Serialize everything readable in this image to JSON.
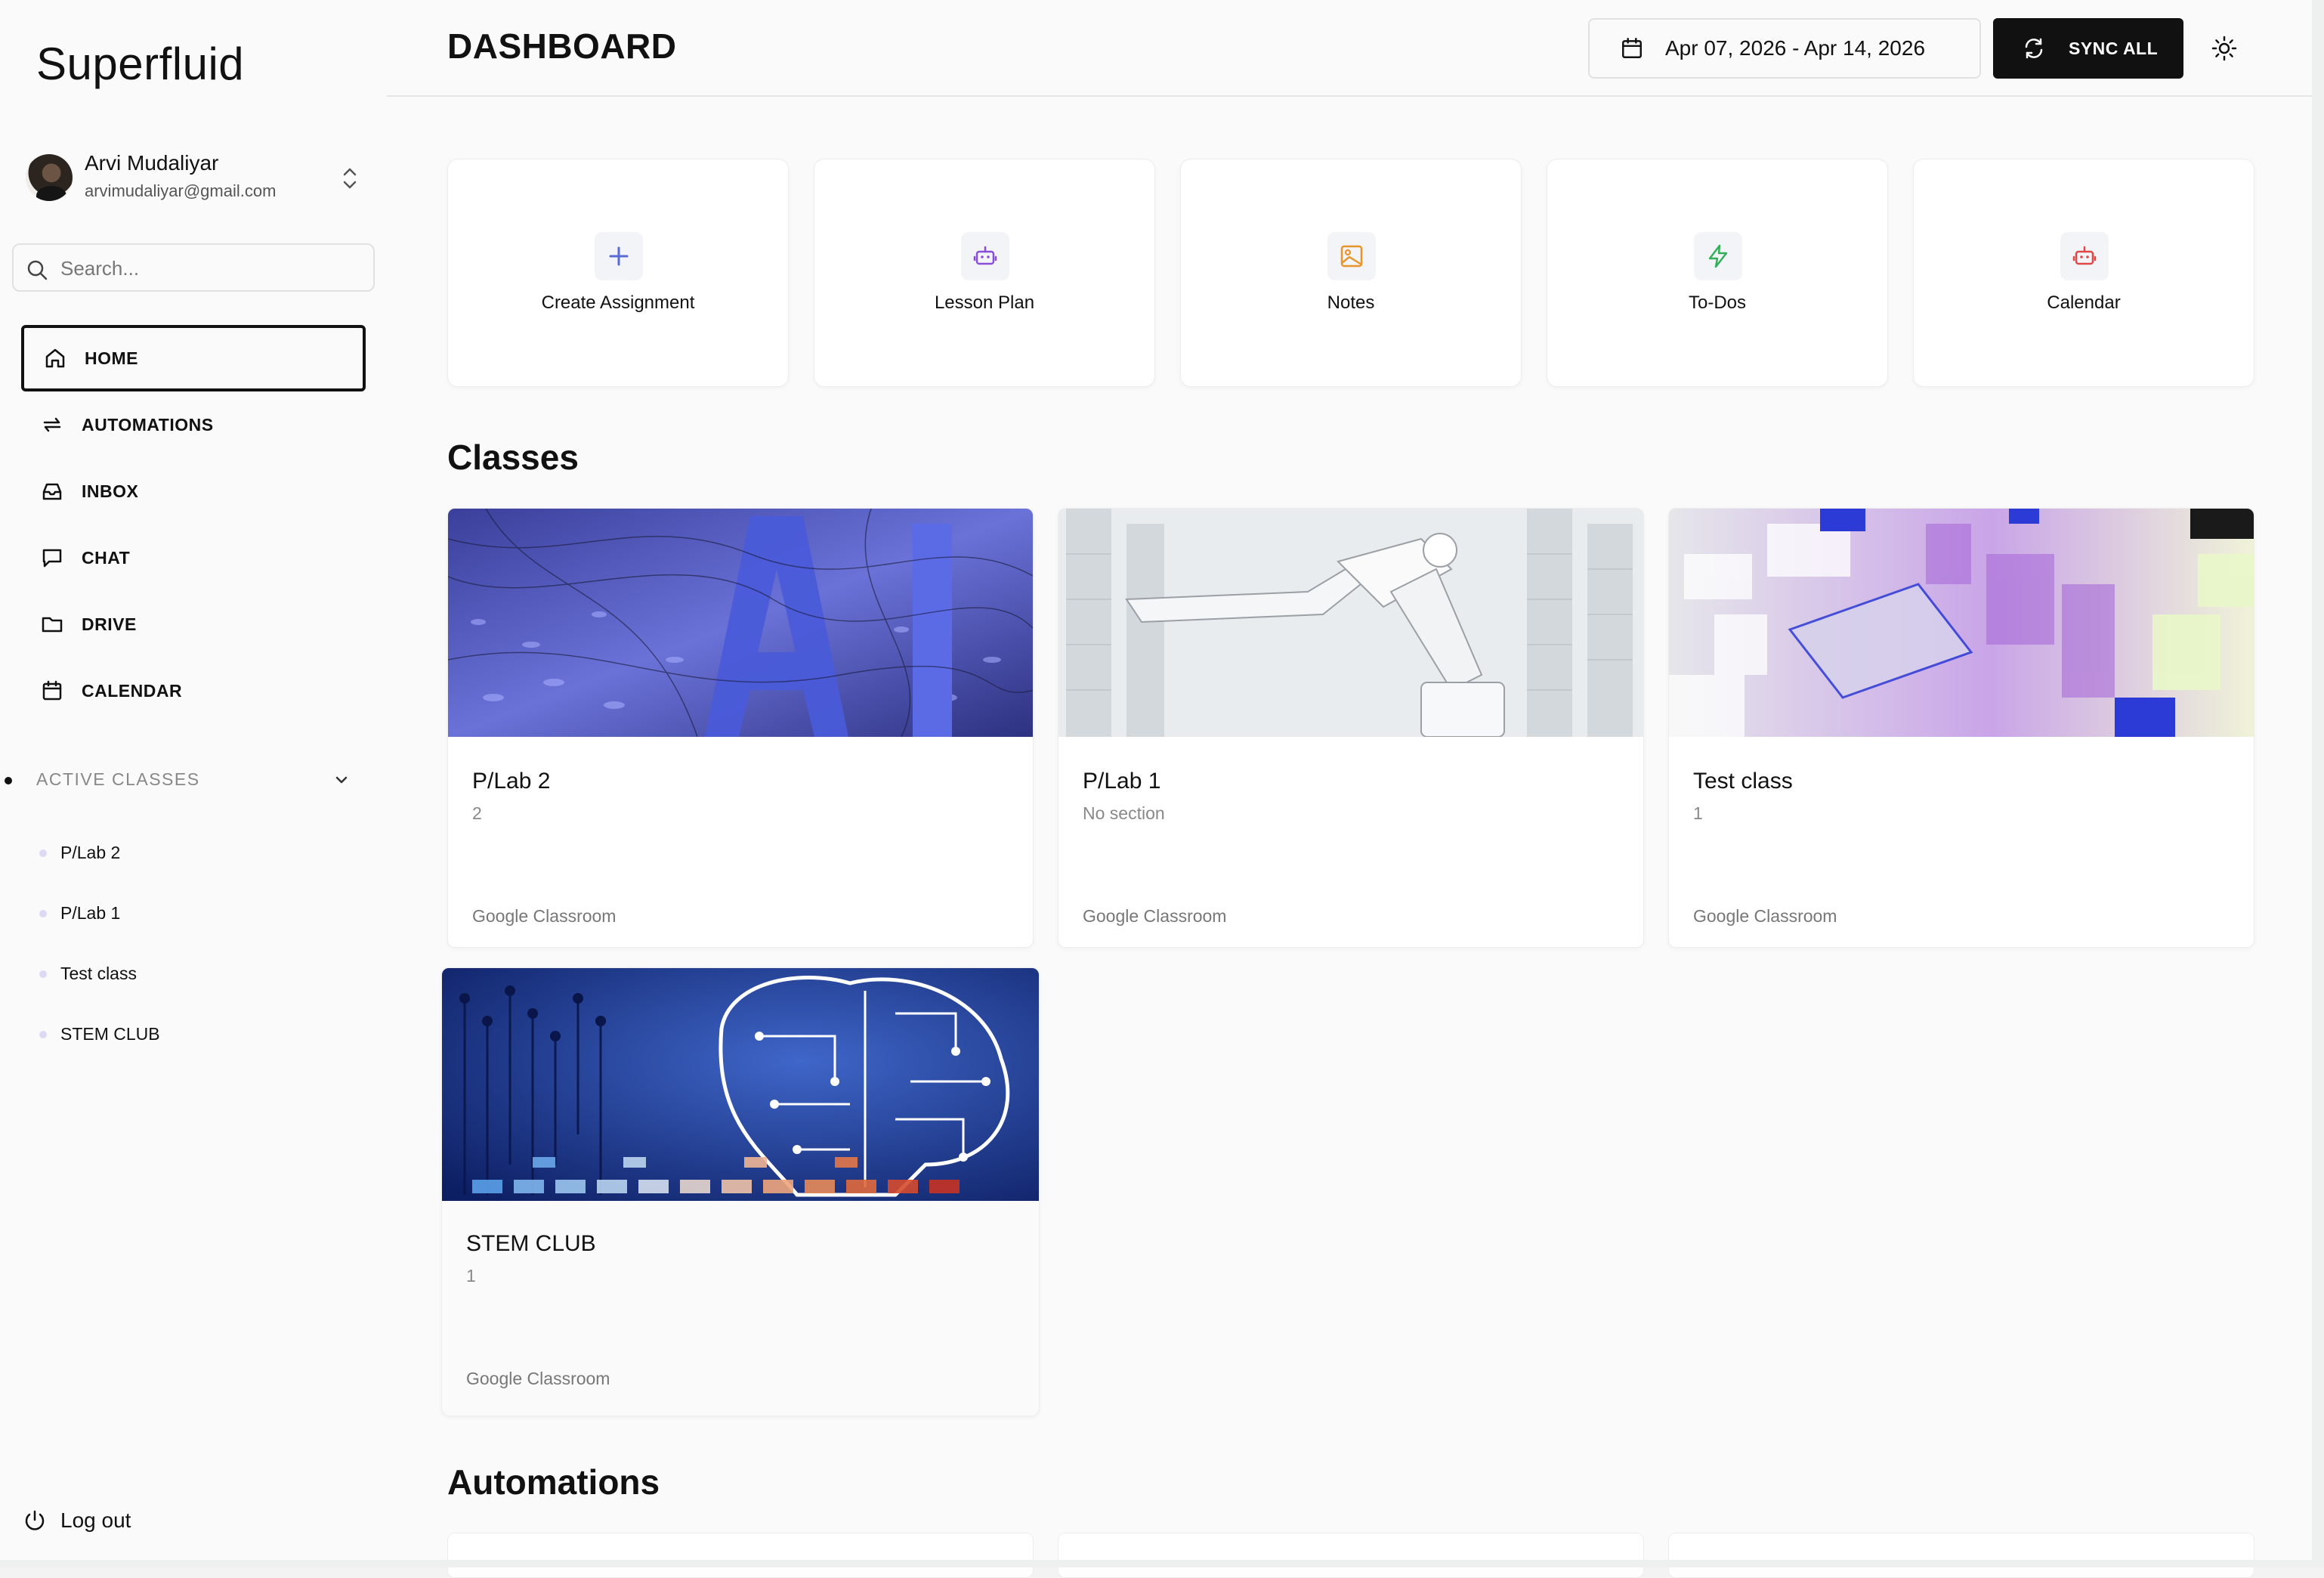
{
  "sidebar": {
    "brand": "Superfluid",
    "user": {
      "name": "Arvi Mudaliyar",
      "email": "arvimudaliyar@gmail.com"
    },
    "search_placeholder": "Search...",
    "nav": [
      {
        "label": "HOME",
        "icon": "home-icon",
        "active": true
      },
      {
        "label": "AUTOMATIONS",
        "icon": "repeat-icon"
      },
      {
        "label": "INBOX",
        "icon": "inbox-icon"
      },
      {
        "label": "CHAT",
        "icon": "chat-icon"
      },
      {
        "label": "DRIVE",
        "icon": "folder-icon"
      },
      {
        "label": "CALENDAR",
        "icon": "calendar-icon"
      }
    ],
    "active_classes_title": "ACTIVE CLASSES",
    "classes": [
      "P/Lab 2",
      "P/Lab 1",
      "Test class",
      "STEM CLUB"
    ],
    "logout_label": "Log out"
  },
  "header": {
    "title": "DASHBOARD",
    "date_range": "Apr 07, 2026 - Apr 14, 2026",
    "sync_label": "SYNC ALL"
  },
  "quick_actions": [
    {
      "label": "Create Assignment",
      "icon": "plus-icon",
      "color": "#5b6bd6"
    },
    {
      "label": "Lesson Plan",
      "icon": "bot-icon",
      "color": "#8a4fd8"
    },
    {
      "label": "Notes",
      "icon": "image-icon",
      "color": "#e8962b"
    },
    {
      "label": "To-Dos",
      "icon": "bolt-icon",
      "color": "#35b05a"
    },
    {
      "label": "Calendar",
      "icon": "bot-icon",
      "color": "#e04848"
    }
  ],
  "classes_section": {
    "title": "Classes",
    "cards": [
      {
        "name": "P/Lab 2",
        "section": "2",
        "source": "Google Classroom"
      },
      {
        "name": "P/Lab 1",
        "section": "No section",
        "source": "Google Classroom"
      },
      {
        "name": "Test class",
        "section": "1",
        "source": "Google Classroom"
      },
      {
        "name": "STEM CLUB",
        "section": "1",
        "source": "Google Classroom"
      }
    ]
  },
  "automations_section": {
    "title": "Automations"
  },
  "colors": {
    "accent": "#111111",
    "class_bullet": "#ddd9f2"
  }
}
